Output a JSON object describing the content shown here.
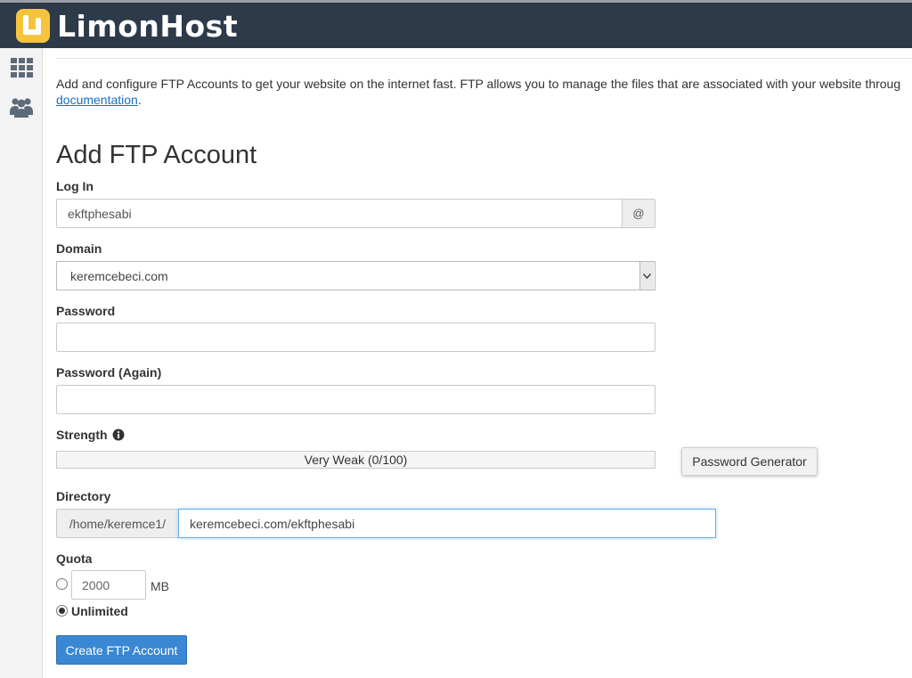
{
  "brand": {
    "name": "LimonHost",
    "logo_color": "#f6c43c",
    "header_bg": "#2d3a4a"
  },
  "sidebar": {
    "items": [
      {
        "icon": "grid-icon"
      },
      {
        "icon": "users-icon"
      }
    ]
  },
  "intro": {
    "text": "Add and configure FTP Accounts to get your website on the internet fast. FTP allows you to manage the files that are associated with your website throug",
    "link_text": "documentation",
    "suffix": "."
  },
  "form": {
    "title": "Add FTP Account",
    "login": {
      "label": "Log In",
      "value": "ekftphesabi",
      "addon": "@"
    },
    "domain": {
      "label": "Domain",
      "selected": "keremcebeci.com"
    },
    "password": {
      "label": "Password",
      "value": ""
    },
    "password_again": {
      "label": "Password (Again)",
      "value": ""
    },
    "strength": {
      "label": "Strength",
      "text": "Very Weak (0/100)",
      "score": 0,
      "max": 100
    },
    "password_generator_label": "Password Generator",
    "directory": {
      "label": "Directory",
      "prefix": "/home/keremce1/",
      "value": "keremcebeci.com/ekftphesabi"
    },
    "quota": {
      "label": "Quota",
      "value": "2000",
      "unit": "MB",
      "unlimited_label": "Unlimited",
      "selected": "unlimited"
    },
    "submit_label": "Create FTP Account"
  },
  "colors": {
    "primary_button": "#3a87d3",
    "link": "#1b6ec2",
    "focus_border": "#66afe9"
  }
}
